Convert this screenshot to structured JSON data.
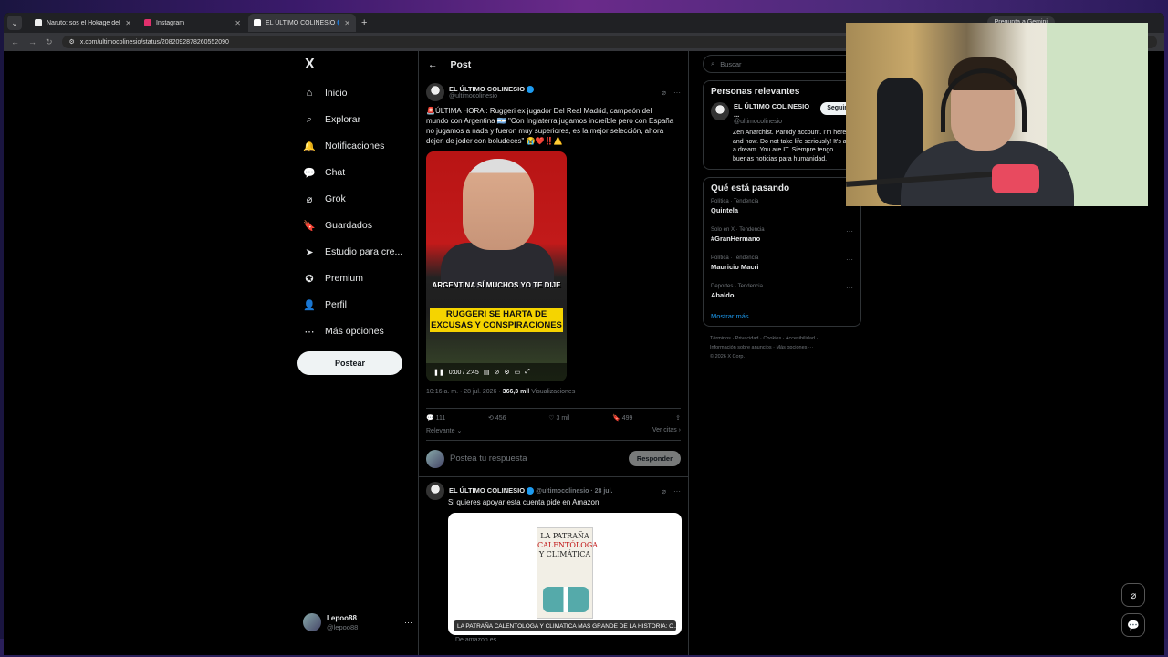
{
  "browser": {
    "tabs": [
      {
        "title": "Naruto: sos el Hokage del stre...",
        "active": false,
        "fav": "#e8e8e8"
      },
      {
        "title": "Instagram",
        "active": false,
        "fav": "#e1306c"
      },
      {
        "title": "EL ÚLTIMO COLINESIO 🔵 en X",
        "active": true,
        "fav": "#ffffff"
      }
    ],
    "url": "x.com/ultimocolinesio/status/2082092878260552090",
    "gemini_label": "Pregunta a Gemini"
  },
  "nav": {
    "logo": "X",
    "items": [
      {
        "label": "Inicio",
        "icon": "home-icon",
        "glyph": "⌂"
      },
      {
        "label": "Explorar",
        "icon": "search-icon",
        "glyph": "⌕"
      },
      {
        "label": "Notificaciones",
        "icon": "bell-icon",
        "glyph": "🔔"
      },
      {
        "label": "Chat",
        "icon": "chat-icon",
        "glyph": "💬"
      },
      {
        "label": "Grok",
        "icon": "grok-icon",
        "glyph": "⌀"
      },
      {
        "label": "Guardados",
        "icon": "bookmark-icon",
        "glyph": "🔖"
      },
      {
        "label": "Estudio para cre...",
        "icon": "rocket-icon",
        "glyph": "➤"
      },
      {
        "label": "Premium",
        "icon": "premium-icon",
        "glyph": "✪"
      },
      {
        "label": "Perfil",
        "icon": "profile-icon",
        "glyph": "👤"
      },
      {
        "label": "Más opciones",
        "icon": "more-icon",
        "glyph": "⋯"
      }
    ],
    "post_button": "Postear",
    "account": {
      "name": "Lepoo88",
      "handle": "@lepoo88"
    }
  },
  "main": {
    "header": "Post",
    "tweet": {
      "name": "EL ÚLTIMO COLINESIO",
      "handle": "@ultimocolinesio",
      "text": "🚨ÚLTIMA HORA : Ruggeri ex jugador Del Real Madrid, campeón del mundo con Argentina 🇦🇷 \"Con Inglaterra jugamos increíble pero con España no jugamos a nada y fueron muy superiores, es la mejor selección, ahora dejen de joder con boludeces\" 😭❤️‼️⚠️",
      "video_caption_1": "ARGENTINA SÍ MUCHOS YO TE DIJE",
      "video_caption_2": "RUGGERI SE HARTA DE EXCUSAS Y CONSPIRACIONES",
      "video_time": "0:00 / 2:45",
      "time": "10:16 a. m. · 28 jul. 2026 · ",
      "views": "366,3 mil",
      "views_label": " Visualizaciones",
      "replies": "111",
      "reposts": "456",
      "likes": "3 mil",
      "bookmarks": "499",
      "sort_label": "Relevante",
      "quotes_label": "Ver citas"
    },
    "reply_placeholder": "Postea tu respuesta",
    "reply_button": "Responder",
    "reply_tweet": {
      "name": "EL ÚLTIMO COLINESIO",
      "handle": "@ultimocolinesio · 28 jul.",
      "text": "Si quieres apoyar esta cuenta pide en Amazon",
      "book_line1": "LA PATRAÑA",
      "book_line2": "CALENTÓLOGA",
      "book_line3": "Y CLIMÁTICA",
      "card_caption": "LA PATRAÑA CALENTOLOGA Y CLIMATICA MAS GRANDE DE LA HISTORIA: O...",
      "from": "De amazon.es"
    }
  },
  "right": {
    "search_placeholder": "Buscar",
    "relevant_title": "Personas relevantes",
    "relevant": {
      "name": "EL ÚLTIMO COLINESIO ...",
      "handle": "@ultimocolinesio",
      "follow": "Seguir",
      "bio": "Zen Anarchist. Parody account. I'm here and now. Do not take life seriously! It's all a dream. You are IT. Siempre tengo buenas noticias para humanidad."
    },
    "trends_title": "Qué está pasando",
    "trends": [
      {
        "cat": "Política · Tendencia",
        "name": "Quintela"
      },
      {
        "cat": "Solo en X · Tendencia",
        "name": "#GranHermano"
      },
      {
        "cat": "Política · Tendencia",
        "name": "Mauricio Macri"
      },
      {
        "cat": "Deportes · Tendencia",
        "name": "Abaldo"
      }
    ],
    "show_more": "Mostrar más",
    "footer_line1": "Términos · Privacidad · Cookies · Accesibilidad ·",
    "footer_line2": "Información sobre anuncios · Más opciones ···",
    "footer_line3": "© 2026 X Corp."
  }
}
